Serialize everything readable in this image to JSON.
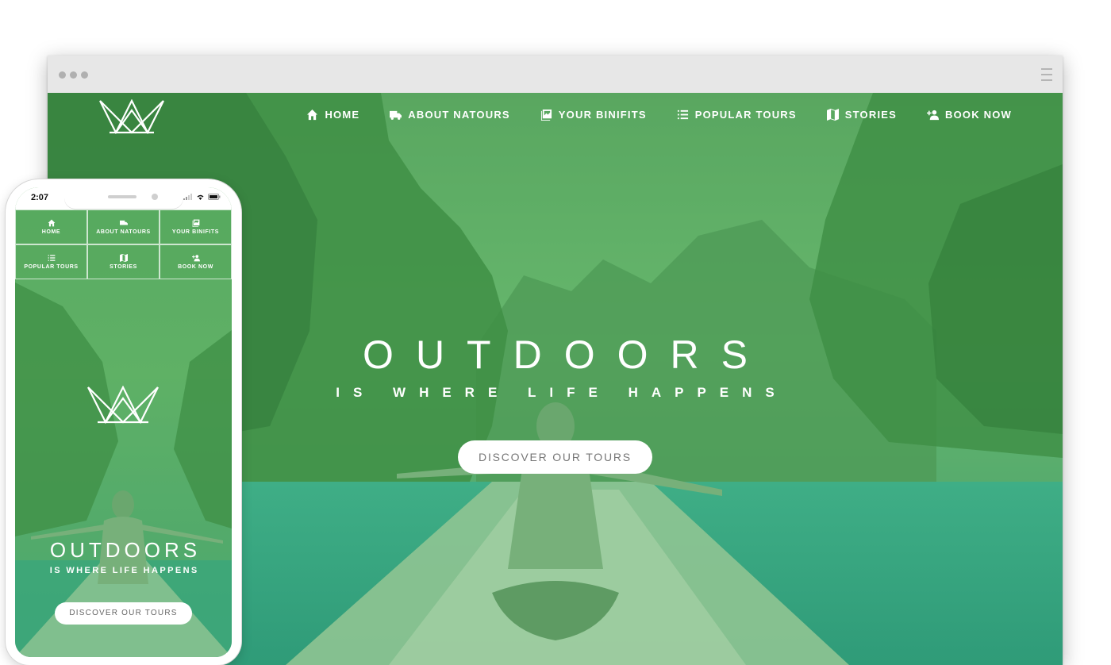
{
  "brand": {
    "logo_icon": "crown-outline-logo"
  },
  "nav": {
    "items": [
      {
        "label": "HOME",
        "icon": "home-icon"
      },
      {
        "label": "ABOUT NATOURS",
        "icon": "truck-icon"
      },
      {
        "label": "YOUR BINIFITS",
        "icon": "gallery-icon"
      },
      {
        "label": "POPULAR TOURS",
        "icon": "list-icon"
      },
      {
        "label": "STORIES",
        "icon": "map-icon"
      },
      {
        "label": "BOOK NOW",
        "icon": "add-user-icon"
      }
    ]
  },
  "hero": {
    "title": "OUTDOORS",
    "subtitle": "IS WHERE LIFE HAPPENS",
    "cta": "DISCOVER OUR TOURS"
  },
  "mobile": {
    "status_time": "2:07",
    "nav": [
      {
        "label": "HOME",
        "icon": "home-icon"
      },
      {
        "label": "ABOUT NATOURS",
        "icon": "truck-icon"
      },
      {
        "label": "YOUR BINIFITS",
        "icon": "gallery-icon"
      },
      {
        "label": "POPULAR TOURS",
        "icon": "list-icon"
      },
      {
        "label": "STORIES",
        "icon": "map-icon"
      },
      {
        "label": "BOOK NOW",
        "icon": "add-user-icon"
      }
    ],
    "hero_title": "OUTDOORS",
    "hero_subtitle": "IS WHERE LIFE HAPPENS",
    "cta": "DISCOVER OUR TOURS"
  },
  "colors": {
    "overlay_green": "#5aab62",
    "white": "#ffffff",
    "button_text": "#777777"
  }
}
